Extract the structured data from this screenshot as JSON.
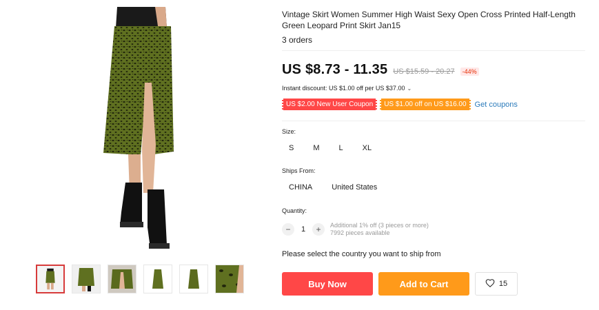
{
  "product": {
    "title": "Vintage Skirt Women Summer High Waist Sexy Open Cross Printed Half-Length Green Leopard Print Skirt Jan15",
    "orders": "3 orders",
    "price": "US $8.73 - 11.35",
    "old_price": "US $15.59 - 20.27",
    "discount": "-44%",
    "instant_discount": "Instant discount: US $1.00 off per US $37.00",
    "instant_chevron": "⌄"
  },
  "coupons": {
    "items": [
      "US $2.00 New User Coupon",
      "US $1.00 off on US $16.00"
    ],
    "get_label": "Get coupons"
  },
  "size": {
    "label": "Size:",
    "options": [
      "S",
      "M",
      "L",
      "XL"
    ]
  },
  "ships_from": {
    "label": "Ships From:",
    "options": [
      "CHINA",
      "United States"
    ]
  },
  "quantity": {
    "label": "Quantity:",
    "minus": "−",
    "value": "1",
    "plus": "+",
    "note_line1": "Additional 1% off (3 pieces or more)",
    "note_line2": "7992 pieces available"
  },
  "ship_message": "Please select the country you want to ship from",
  "actions": {
    "buy_now": "Buy Now",
    "add_to_cart": "Add to Cart",
    "wishlist_count": "15"
  },
  "colors": {
    "accent_red": "#ff4747",
    "accent_orange": "#ff9a1a",
    "link_blue": "#2b7bbb",
    "skirt_green": "#5b6b1e"
  },
  "icons": [
    "heart-icon",
    "chevron-down-icon"
  ]
}
